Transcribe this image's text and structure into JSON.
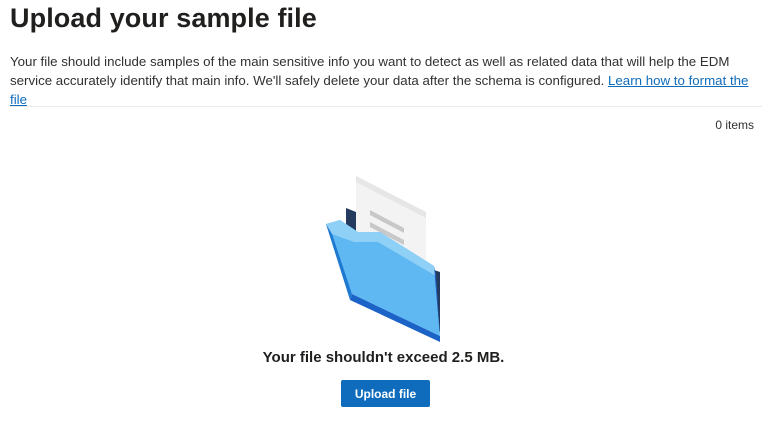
{
  "header": {
    "title": "Upload your sample file"
  },
  "description": {
    "text": "Your file should include samples of the main sensitive info you want to detect as well as related data that will help the EDM service accurately identify that main info. We'll safely delete your data after the schema is configured.",
    "link_label": "Learn how to format the file"
  },
  "list": {
    "item_count": "0 items"
  },
  "empty_state": {
    "illustration_icon": "folder-with-document-icon",
    "message": "Your file shouldn't exceed 2.5 MB.",
    "upload_button_label": "Upload file"
  },
  "colors": {
    "accent": "#0f6cbd",
    "folder_light": "#5fb8f2",
    "folder_dark": "#1b63c7",
    "folder_back": "#243a5e"
  }
}
